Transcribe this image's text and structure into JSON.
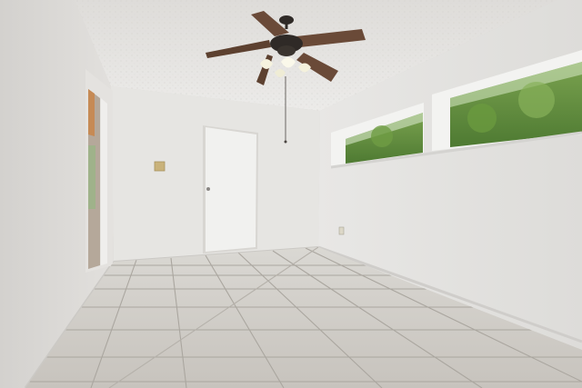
{
  "scene": {
    "kind": "empty-room-interior",
    "elements": [
      "textured-ceiling",
      "ceiling-fan",
      "left-wall",
      "back-wall",
      "right-wall",
      "interior-door",
      "open-doorway",
      "clerestory-windows",
      "tile-floor",
      "light-switch",
      "wall-outlet"
    ]
  },
  "colors": {
    "ceiling": "#e4e3e0",
    "back_wall": "#e9e8e6",
    "left_wall": "#dcdad7",
    "right_wall": "#e2e1df",
    "floor": "#cfccc7",
    "grout": "#a9a59f",
    "door": "#f2f2f1",
    "fan_blade": "#6a4a38",
    "fan_body": "#2f2a27",
    "foliage": "#5f8a3c",
    "sky": "#d5e6c9",
    "switch_plate": "#c9b27a"
  },
  "fan": {
    "lights": 4,
    "blades": 5
  }
}
